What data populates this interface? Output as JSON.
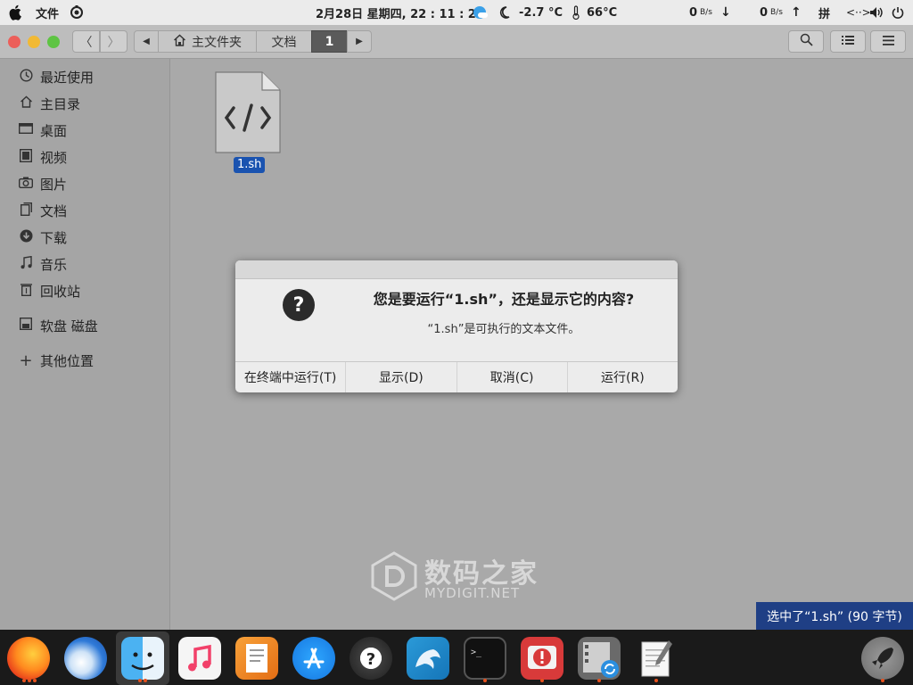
{
  "topbar": {
    "file_menu": "文件",
    "clock": "2月28日 星期四, 22 : 11 : 28",
    "temperature": "-2.7 °C",
    "cpu_temp": "66°C",
    "net_down": "0",
    "net_down_unit": "B/s",
    "net_up": "0",
    "net_up_unit": "B/s",
    "input_method": "拼"
  },
  "headerbar": {
    "crumbs": [
      "主文件夹",
      "文档",
      "1"
    ]
  },
  "sidebar": {
    "items": [
      {
        "label": "最近使用",
        "icon": "clock-icon"
      },
      {
        "label": "主目录",
        "icon": "home-icon"
      },
      {
        "label": "桌面",
        "icon": "desktop-icon"
      },
      {
        "label": "视频",
        "icon": "video-icon"
      },
      {
        "label": "图片",
        "icon": "camera-icon"
      },
      {
        "label": "文档",
        "icon": "document-icon"
      },
      {
        "label": "下载",
        "icon": "download-icon"
      },
      {
        "label": "音乐",
        "icon": "music-icon"
      },
      {
        "label": "回收站",
        "icon": "trash-icon"
      },
      {
        "label": "软盘 磁盘",
        "icon": "floppy-icon"
      },
      {
        "label": "其他位置",
        "icon": "plus-icon"
      }
    ]
  },
  "file": {
    "name": "1.sh"
  },
  "dialog": {
    "title": "您是要运行“1.sh”，还是显示它的内容?",
    "message": "“1.sh”是可执行的文本文件。",
    "actions": [
      "在终端中运行(T)",
      "显示(D)",
      "取消(C)",
      "运行(R)"
    ]
  },
  "status": {
    "text": "选中了“1.sh” (90 字节)"
  },
  "watermark": {
    "title": "数码之家",
    "subtitle": "MYDIGIT.NET"
  },
  "dock": {
    "apps": [
      "firefox-icon",
      "thunderbird-icon",
      "finder-icon",
      "music-app-icon",
      "pages-icon",
      "appstore-icon",
      "help-icon",
      "mysql-workbench-icon",
      "terminal-icon",
      "alert-app-icon",
      "video-converter-icon",
      "textedit-icon",
      "launchpad-icon"
    ]
  },
  "colors": {
    "accent": "#1f3f85",
    "selection": "#1a53b0",
    "close": "#ec5f5a",
    "minimize": "#f1b934",
    "maximize": "#5ec443"
  }
}
